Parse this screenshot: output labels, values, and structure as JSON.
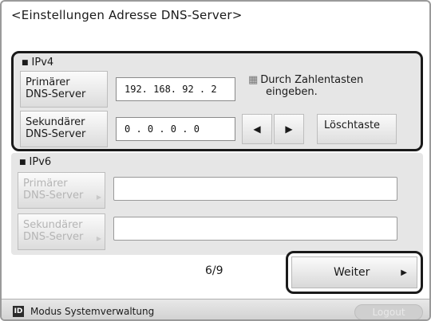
{
  "title": "<Einstellungen Adresse DNS-Server>",
  "ipv4": {
    "section_label": "IPv4",
    "primary_label_1": "Primärer",
    "primary_label_2": "DNS-Server",
    "primary_value": "192. 168. 92 . 2",
    "secondary_label_1": "Sekundärer",
    "secondary_label_2": "DNS-Server",
    "secondary_value": "0 . 0 . 0 . 0",
    "hint_line1": "Durch Zahlentasten",
    "hint_line2": "eingeben.",
    "left_arrow": "◀",
    "right_arrow": "▶",
    "clear_label": "Löschtaste"
  },
  "ipv6": {
    "section_label": "IPv6",
    "primary_label_1": "Primärer",
    "primary_label_2": "DNS-Server",
    "primary_value": "",
    "secondary_label_1": "Sekundärer",
    "secondary_label_2": "DNS-Server",
    "secondary_value": ""
  },
  "page_indicator": "6/9",
  "next_label": "Weiter",
  "footer": {
    "mode_icon_text": "ID",
    "mode_label": "Modus Systemverwaltung",
    "logout_label": "Logout"
  },
  "colors": {
    "panel_bg": "#e6e6e6",
    "highlight_border": "#1a1a1a",
    "disabled_text": "#b5b5b5"
  }
}
